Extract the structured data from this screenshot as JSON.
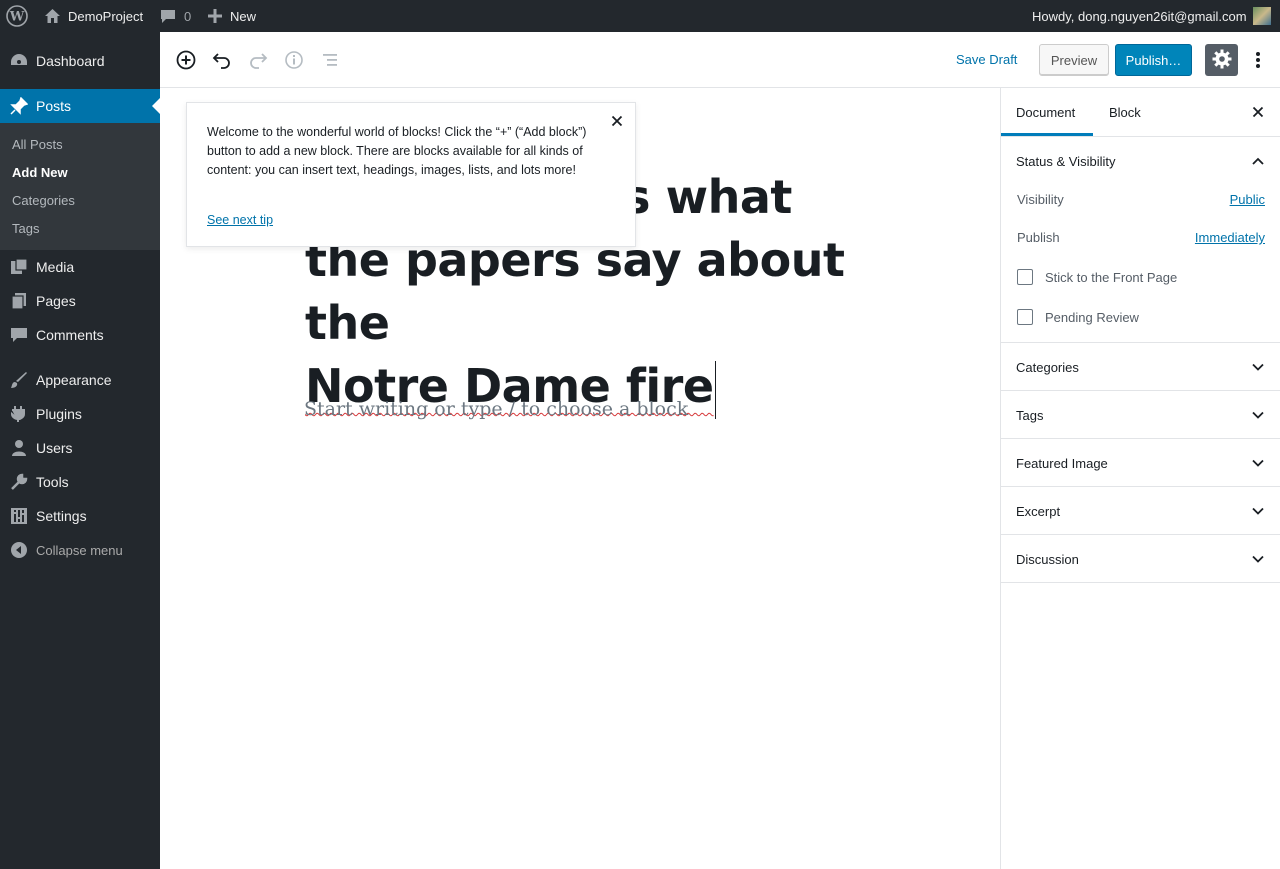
{
  "admin_bar": {
    "site_name": "DemoProject",
    "comments_count": "0",
    "new_label": "New",
    "greeting": "Howdy, dong.nguyen26it@gmail.com"
  },
  "admin_menu": {
    "items": [
      {
        "label": "Dashboard",
        "icon": "dashboard-icon"
      },
      {
        "label": "Posts",
        "icon": "pin-icon"
      },
      {
        "label": "Media",
        "icon": "media-icon"
      },
      {
        "label": "Pages",
        "icon": "pages-icon"
      },
      {
        "label": "Comments",
        "icon": "comments-icon"
      },
      {
        "label": "Appearance",
        "icon": "appearance-icon"
      },
      {
        "label": "Plugins",
        "icon": "plugins-icon"
      },
      {
        "label": "Users",
        "icon": "users-icon"
      },
      {
        "label": "Tools",
        "icon": "tools-icon"
      },
      {
        "label": "Settings",
        "icon": "settings-icon"
      }
    ],
    "posts_submenu": [
      "All Posts",
      "Add New",
      "Categories",
      "Tags"
    ],
    "collapse_label": "Collapse menu"
  },
  "editor_header": {
    "save_draft": "Save Draft",
    "preview": "Preview",
    "publish": "Publish…"
  },
  "tip": {
    "text": "Welcome to the wonderful world of blocks! Click the “+” (“Add block”) button to add a new block. There are blocks available for all kinds of content: you can insert text, headings, images, lists, and lots more!",
    "link": "See next tip"
  },
  "post": {
    "title": "Here’s what the papers say about the Notre Dame fire",
    "title_visible_line1": "rs what",
    "title_line2": "the papers say about the",
    "title_line3": "Notre Dame fire",
    "body_placeholder": "Start writing or type / to choose a block"
  },
  "sidebar": {
    "tabs": [
      "Document",
      "Block"
    ],
    "active_tab": "Document",
    "status_panel": {
      "title": "Status & Visibility",
      "visibility_label": "Visibility",
      "visibility_value": "Public",
      "publish_label": "Publish",
      "publish_value": "Immediately",
      "stick_label": "Stick to the Front Page",
      "pending_label": "Pending Review"
    },
    "panels": [
      "Categories",
      "Tags",
      "Featured Image",
      "Excerpt",
      "Discussion"
    ]
  },
  "colors": {
    "admin_bg": "#23282d",
    "accent": "#0073aa",
    "publish_bg": "#0085ba"
  }
}
